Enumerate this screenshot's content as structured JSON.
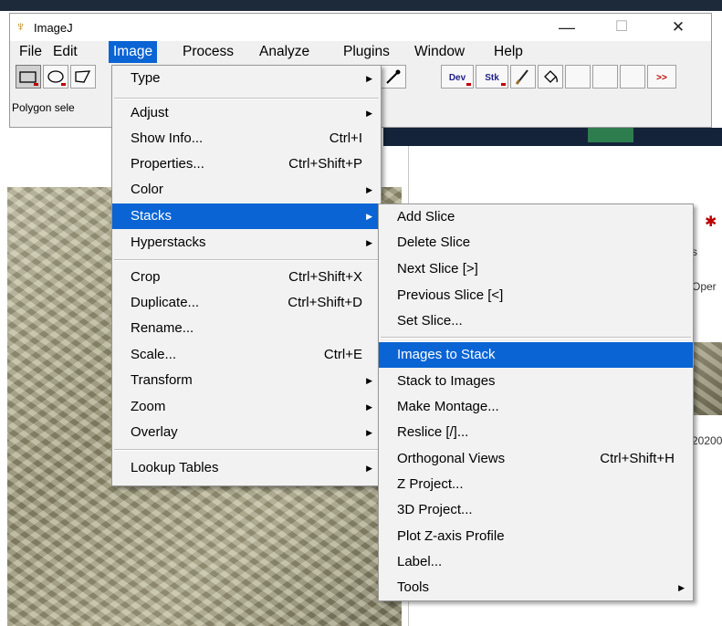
{
  "window": {
    "title": "ImageJ",
    "minimize_glyph": "—",
    "maximize_glyph": "☐",
    "close_glyph": "✕"
  },
  "menubar": [
    {
      "label": "File"
    },
    {
      "label": "Edit"
    },
    {
      "label": "Image",
      "active": true
    },
    {
      "label": "Process"
    },
    {
      "label": "Analyze"
    },
    {
      "label": "Plugins"
    },
    {
      "label": "Window"
    },
    {
      "label": "Help"
    }
  ],
  "toolbar": {
    "tools": [
      {
        "icon": "rectangle-tool-icon",
        "selected": true
      },
      {
        "icon": "oval-tool-icon"
      },
      {
        "icon": "polygon-tool-icon"
      }
    ],
    "right_tools": [
      {
        "icon": "dropper-tool-icon",
        "glyph": "✎"
      },
      {
        "icon": "dev-menu-icon",
        "text": "Dev"
      },
      {
        "icon": "stk-menu-icon",
        "text": "Stk"
      },
      {
        "icon": "brush-tool-icon",
        "glyph": "🖌"
      },
      {
        "icon": "flood-fill-icon",
        "glyph": "⛾"
      },
      {
        "icon": "more-tools-icon",
        "text": ">>"
      }
    ]
  },
  "status_text": "Polygon sele",
  "image_menu": {
    "items": [
      {
        "label": "Type",
        "submenu": true
      },
      {
        "label": "Adjust",
        "submenu": true
      },
      {
        "label": "Show Info...",
        "shortcut": "Ctrl+I"
      },
      {
        "label": "Properties...",
        "shortcut": "Ctrl+Shift+P"
      },
      {
        "label": "Color",
        "submenu": true
      },
      {
        "label": "Stacks",
        "submenu": true,
        "highlighted": true
      },
      {
        "label": "Hyperstacks",
        "submenu": true
      },
      {
        "label": "Crop",
        "shortcut": "Ctrl+Shift+X"
      },
      {
        "label": "Duplicate...",
        "shortcut": "Ctrl+Shift+D"
      },
      {
        "label": "Rename..."
      },
      {
        "label": "Scale...",
        "shortcut": "Ctrl+E"
      },
      {
        "label": "Transform",
        "submenu": true
      },
      {
        "label": "Zoom",
        "submenu": true
      },
      {
        "label": "Overlay",
        "submenu": true
      },
      {
        "label": "Lookup Tables",
        "submenu": true
      }
    ]
  },
  "stacks_menu": {
    "items": [
      {
        "label": "Add Slice"
      },
      {
        "label": "Delete Slice"
      },
      {
        "label": "Next Slice [>]"
      },
      {
        "label": "Previous Slice [<]"
      },
      {
        "label": "Set Slice..."
      },
      {
        "label": "Images to Stack",
        "highlighted": true
      },
      {
        "label": "Stack to Images"
      },
      {
        "label": "Make Montage..."
      },
      {
        "label": "Reslice [/]..."
      },
      {
        "label": "Orthogonal Views",
        "shortcut": "Ctrl+Shift+H"
      },
      {
        "label": "Z Project..."
      },
      {
        "label": "3D Project..."
      },
      {
        "label": "Plot Z-axis Profile"
      },
      {
        "label": "Label..."
      },
      {
        "label": "Tools",
        "submenu": true
      }
    ]
  },
  "background": {
    "right_fragments": [
      "s",
      "Oper",
      "20200"
    ]
  },
  "colors": {
    "highlight": "#0a64d4",
    "menu_bg": "#f2f2f2"
  }
}
